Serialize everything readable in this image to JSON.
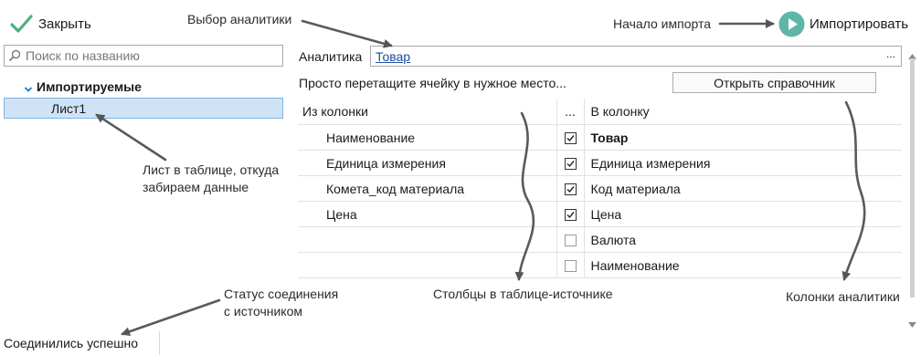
{
  "toolbar": {
    "close_label": "Закрыть",
    "import_label": "Импортировать"
  },
  "search": {
    "placeholder": "Поиск по названию"
  },
  "tree": {
    "group_label": "Импортируемые",
    "items": [
      {
        "label": "Лист1",
        "selected": true
      }
    ]
  },
  "analytics": {
    "label": "Аналитика",
    "value": "Товар",
    "ellipsis": "..."
  },
  "hint_text": "Просто перетащите ячейку в нужное место...",
  "open_directory_label": "Открыть справочник",
  "mapping": {
    "headers": {
      "from": "Из колонки",
      "check": "...",
      "to": "В колонку"
    },
    "rows": [
      {
        "from": "Наименование",
        "checked": true,
        "to": "Товар",
        "to_bold": true
      },
      {
        "from": "Единица измерения",
        "checked": true,
        "to": "Единица измерения",
        "to_bold": false
      },
      {
        "from": "Комета_код материала",
        "checked": true,
        "to": "Код материала",
        "to_bold": false
      },
      {
        "from": "Цена",
        "checked": true,
        "to": "Цена",
        "to_bold": false
      },
      {
        "from": "",
        "checked": false,
        "to": "Валюта",
        "to_bold": false
      },
      {
        "from": "",
        "checked": false,
        "to": "Наименование",
        "to_bold": false
      }
    ]
  },
  "status_text": "Соединились успешно",
  "annotations": {
    "analytics_choice": "Выбор аналитики",
    "import_start": "Начало импорта",
    "sheet_line1": "Лист в таблице, откуда",
    "sheet_line2": "забираем данные",
    "status_line1": "Статус соединения",
    "status_line2": "с источником",
    "source_columns": "Столбцы в таблице-источнике",
    "analytics_columns": "Колонки аналитики"
  },
  "colors": {
    "accent_green": "#4caf82",
    "play_teal": "#5fb5a6",
    "selection_bg": "#cfe3f6",
    "link_blue": "#1f4e9c"
  }
}
